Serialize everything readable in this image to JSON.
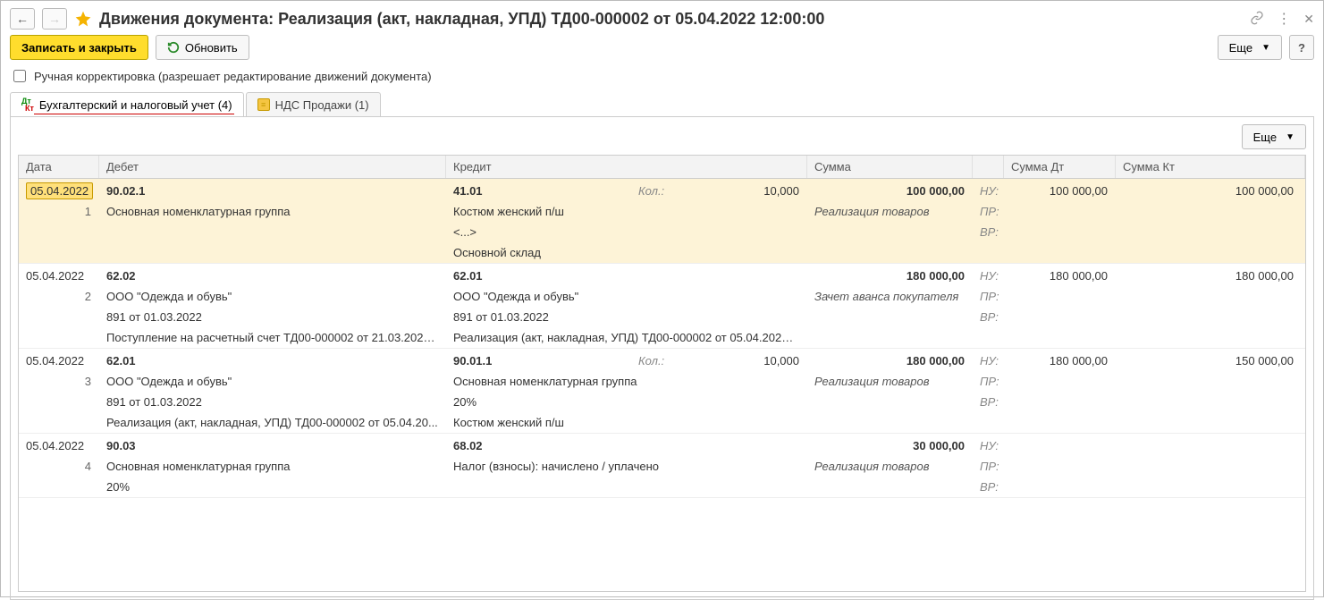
{
  "header": {
    "title": "Движения документа: Реализация (акт, накладная, УПД) ТД00-000002 от 05.04.2022 12:00:00"
  },
  "toolbar": {
    "save_close": "Записать и закрыть",
    "refresh": "Обновить",
    "more": "Еще",
    "help": "?"
  },
  "manual_edit": {
    "label": "Ручная корректировка (разрешает редактирование движений документа)",
    "checked": false
  },
  "tabs": {
    "accounting": "Бухгалтерский и налоговый учет (4)",
    "vat": "НДС Продажи (1)"
  },
  "inner_toolbar": {
    "more": "Еще"
  },
  "columns": {
    "date": "Дата",
    "debit": "Дебет",
    "credit": "Кредит",
    "sum": "Сумма",
    "sum_dt": "Сумма Дт",
    "sum_kt": "Сумма Кт"
  },
  "labels": {
    "qty": "Кол.:",
    "nu": "НУ:",
    "pr": "ПР:",
    "vr": "ВР:"
  },
  "entries": [
    {
      "date": "05.04.2022",
      "num": "1",
      "debit_acct": "90.02.1",
      "credit_acct": "41.01",
      "qty": "10,000",
      "sum": "100 000,00",
      "sum_dt": "100 000,00",
      "sum_kt": "100 000,00",
      "op": "Реализация товаров",
      "debit_lines": [
        "Основная номенклатурная группа"
      ],
      "credit_lines": [
        "Костюм женский п/ш",
        "<...>",
        "Основной склад"
      ]
    },
    {
      "date": "05.04.2022",
      "num": "2",
      "debit_acct": "62.02",
      "credit_acct": "62.01",
      "qty": "",
      "sum": "180 000,00",
      "sum_dt": "180 000,00",
      "sum_kt": "180 000,00",
      "op": "Зачет аванса покупателя",
      "debit_lines": [
        "ООО \"Одежда и обувь\"",
        "891 от 01.03.2022",
        "Поступление на расчетный счет ТД00-000002 от 21.03.2022..."
      ],
      "credit_lines": [
        "ООО \"Одежда и обувь\"",
        "891 от 01.03.2022",
        "Реализация (акт, накладная, УПД) ТД00-000002 от 05.04.2022 ..."
      ]
    },
    {
      "date": "05.04.2022",
      "num": "3",
      "debit_acct": "62.01",
      "credit_acct": "90.01.1",
      "qty": "10,000",
      "sum": "180 000,00",
      "sum_dt": "180 000,00",
      "sum_kt": "150 000,00",
      "op": "Реализация товаров",
      "debit_lines": [
        "ООО \"Одежда и обувь\"",
        "891 от 01.03.2022",
        "Реализация (акт, накладная, УПД) ТД00-000002 от 05.04.20..."
      ],
      "credit_lines": [
        "Основная номенклатурная группа",
        "20%",
        "Костюм женский п/ш"
      ]
    },
    {
      "date": "05.04.2022",
      "num": "4",
      "debit_acct": "90.03",
      "credit_acct": "68.02",
      "qty": "",
      "sum": "30 000,00",
      "sum_dt": "",
      "sum_kt": "",
      "op": "Реализация товаров",
      "debit_lines": [
        "Основная номенклатурная группа",
        "20%"
      ],
      "credit_lines": [
        "Налог (взносы): начислено / уплачено",
        ""
      ]
    }
  ]
}
